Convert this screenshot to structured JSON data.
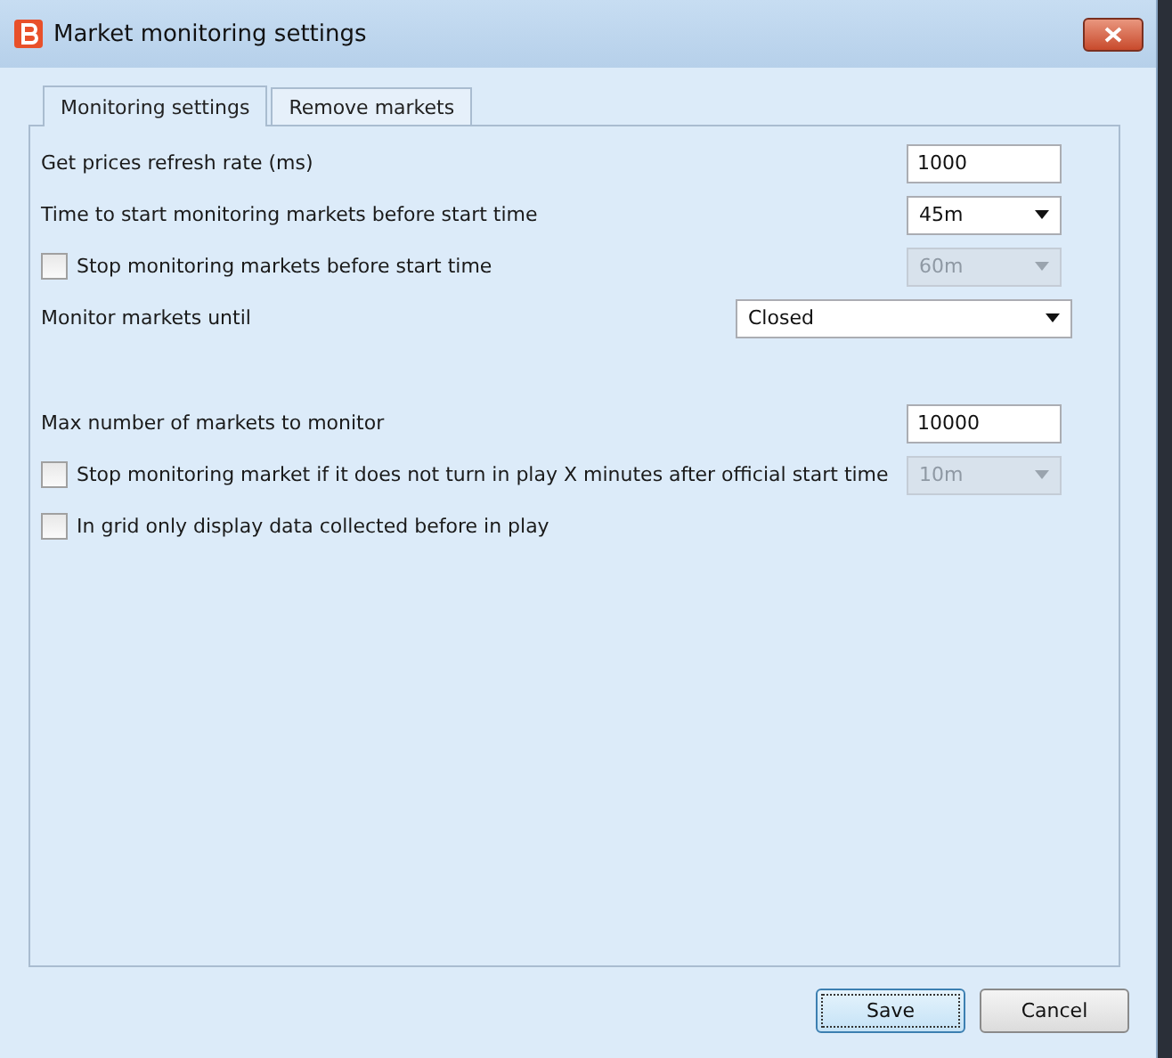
{
  "window": {
    "title": "Market monitoring settings"
  },
  "tabs": [
    {
      "label": "Monitoring settings",
      "selected": true
    },
    {
      "label": "Remove markets",
      "selected": false
    }
  ],
  "groups": [
    [
      {
        "kind": "input",
        "label": "Get prices refresh rate (ms)",
        "value": "1000"
      },
      {
        "kind": "select",
        "label": "Time to start monitoring markets before start time",
        "value": "45m",
        "disabled": false
      },
      {
        "kind": "checkbox-select",
        "label": "Stop monitoring markets before start time",
        "checked": false,
        "value": "60m",
        "disabled": true
      },
      {
        "kind": "wide-select",
        "label": "Monitor markets until",
        "value": "Closed",
        "disabled": false
      }
    ],
    [
      {
        "kind": "input",
        "label": "Max number of markets to monitor",
        "value": "10000"
      },
      {
        "kind": "checkbox-select",
        "label": "Stop monitoring market if it does not turn in play X minutes after official start time",
        "checked": false,
        "value": "10m",
        "disabled": true
      },
      {
        "kind": "checkbox",
        "label": "In grid only display data collected before in play",
        "checked": false
      }
    ]
  ],
  "buttons": [
    {
      "label": "Save",
      "default": true
    },
    {
      "label": "Cancel",
      "default": false
    }
  ]
}
